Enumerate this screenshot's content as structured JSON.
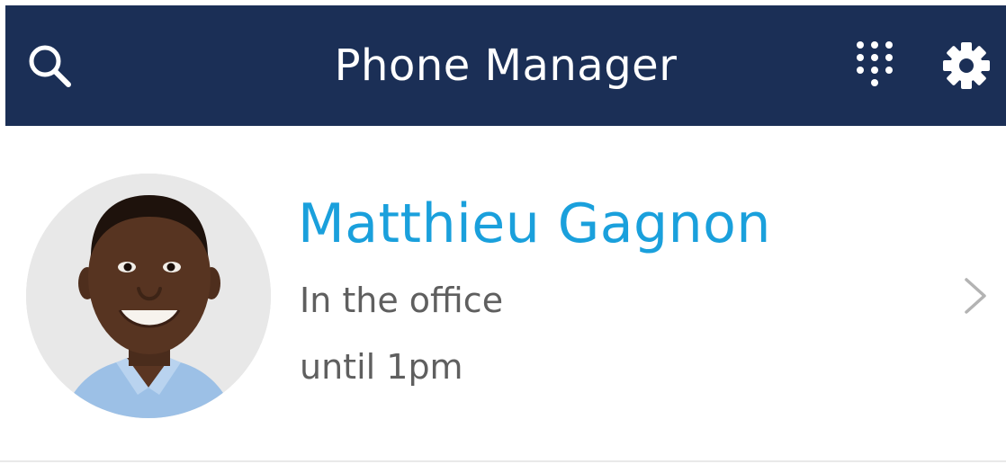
{
  "header": {
    "title": "Phone Manager",
    "search_icon": "search-icon",
    "dialpad_icon": "dialpad-icon",
    "settings_icon": "gear-icon",
    "background_color": "#1b2f56"
  },
  "contact": {
    "name": "Matthieu Gagnon",
    "status": "In the office",
    "until": "until 1pm",
    "name_color": "#1aa0dc",
    "avatar_icon": "avatar",
    "chevron_icon": "chevron-right-icon"
  }
}
